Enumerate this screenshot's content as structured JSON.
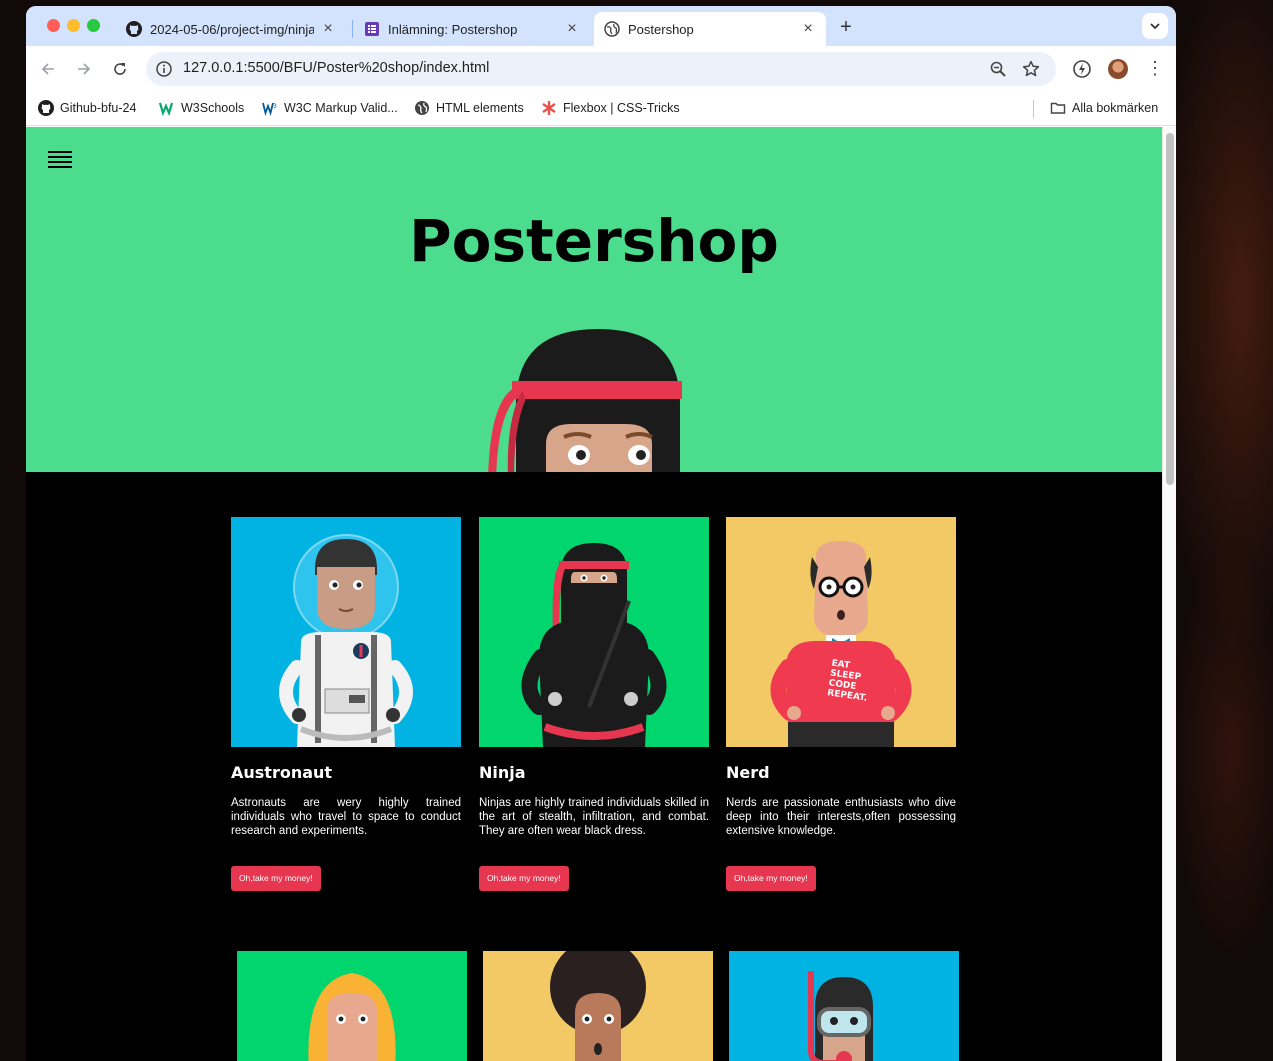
{
  "browser": {
    "tabs": [
      {
        "title": "2024-05-06/project-img/ninja",
        "close": "×"
      },
      {
        "title": "Inlämning: Postershop",
        "close": "×"
      },
      {
        "title": "Postershop",
        "close": "×"
      }
    ],
    "new_tab": "+",
    "url": "127.0.0.1:5500/BFU/Poster%20shop/index.html",
    "bookmarks": [
      {
        "label": "Github-bfu-24",
        "icon": "github-icon"
      },
      {
        "label": "W3Schools",
        "icon": "w3schools-icon"
      },
      {
        "label": "W3C Markup Valid...",
        "icon": "w3c-icon"
      },
      {
        "label": "HTML elements",
        "icon": "globe-icon"
      },
      {
        "label": "Flexbox | CSS-Tricks",
        "icon": "css-tricks-icon"
      }
    ],
    "all_bookmarks": "Alla bokmärken"
  },
  "page": {
    "title": "Postershop",
    "hero_color": "#4cdc8e",
    "button_color": "#e63650",
    "products": [
      {
        "name": "Austronaut",
        "description": "Astronauts are wery highly trained individuals who travel to space to conduct research and experiments.",
        "button": "Oh,take my money!",
        "bg": "#00b3e3"
      },
      {
        "name": "Ninja",
        "description": "Ninjas are highly trained individuals skilled in the art of stealth, infiltration, and combat. They are often wear black dress.",
        "button": "Oh,take my money!",
        "bg": "#00d56e"
      },
      {
        "name": "Nerd",
        "description": "Nerds are passionate enthusiasts who dive deep into their interests,often possessing extensive knowledge.",
        "button": "Oh,take my money!",
        "bg": "#f3c965",
        "shirt_text": [
          "EAT",
          "SLEEP",
          "CODE",
          "REPEAT."
        ]
      }
    ],
    "next_row_bgs": [
      "#00d56e",
      "#f3c965",
      "#00b3e3"
    ]
  }
}
